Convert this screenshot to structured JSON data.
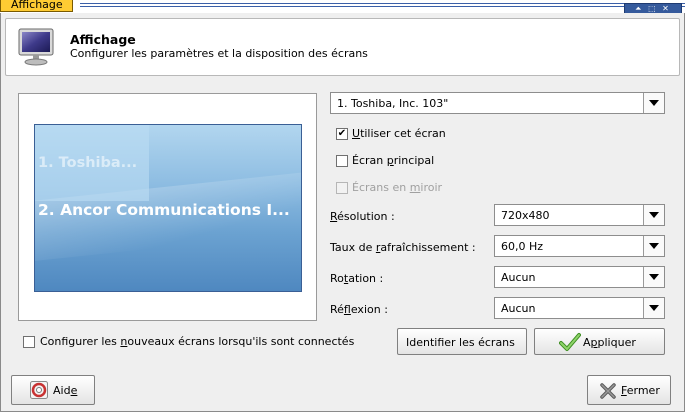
{
  "window": {
    "tab_title": "Affichage",
    "wm_buttons": "⏶ ⬚ ✕"
  },
  "header": {
    "title": "Affichage",
    "subtitle": "Configurer les paramètres et la disposition des écrans",
    "icon": "monitor-icon"
  },
  "preview": {
    "monitor_1_label": "1. Toshiba...",
    "monitor_2_label": "2. Ancor Communications I..."
  },
  "monitor_select": {
    "value": "1. Toshiba, Inc. 103\""
  },
  "options": {
    "use_screen": {
      "pre": "",
      "u": "U",
      "post": "tiliser cet écran",
      "checked": true,
      "mark": "✔"
    },
    "primary": {
      "pre": "Écran ",
      "u": "p",
      "post": "rincipal",
      "checked": false
    },
    "mirror": {
      "pre": "Écrans en ",
      "u": "m",
      "post": "iroir",
      "checked": false,
      "disabled": true
    }
  },
  "settings": {
    "resolution": {
      "pre": "",
      "u": "R",
      "post": "ésolution :",
      "value": "720x480"
    },
    "refresh": {
      "pre": "Taux de ",
      "u": "r",
      "post": "afraîchissement :",
      "value": "60,0 Hz"
    },
    "rotation": {
      "pre": "Ro",
      "u": "t",
      "post": "ation :",
      "value": "Aucun"
    },
    "reflection": {
      "pre": "Ré",
      "u": "f",
      "post": "lexion :",
      "value": "Aucun"
    }
  },
  "auto_configure": {
    "pre": "Configurer les ",
    "u": "n",
    "post": "ouveaux écrans lorsqu'ils sont connectés",
    "checked": false
  },
  "buttons": {
    "identify": "Identifier les écrans",
    "apply": {
      "pre": "A",
      "u": "p",
      "post": "pliquer"
    },
    "help": {
      "pre": "Aid",
      "u": "e",
      "post": ""
    },
    "close": {
      "pre": "",
      "u": "F",
      "post": "ermer"
    }
  },
  "colors": {
    "title_tab": "#ffcc33",
    "preview_blue": "#6ba2d1",
    "apply_check": "#5fb33a",
    "close_x": "#606060",
    "help_red": "#c83232"
  }
}
